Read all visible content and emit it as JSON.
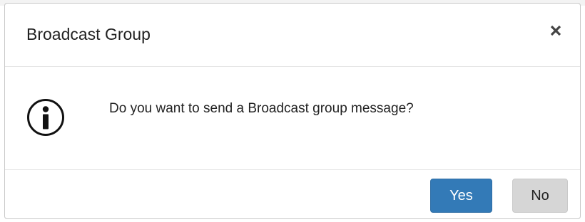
{
  "dialog": {
    "title": "Broadcast Group",
    "close_icon": "close-icon",
    "info_icon": "info-icon",
    "message": "Do you want to send a Broadcast group message?",
    "buttons": {
      "yes_label": "Yes",
      "no_label": "No"
    }
  },
  "colors": {
    "primary": "#337ab7",
    "secondary": "#d6d6d6",
    "text": "#222222"
  }
}
